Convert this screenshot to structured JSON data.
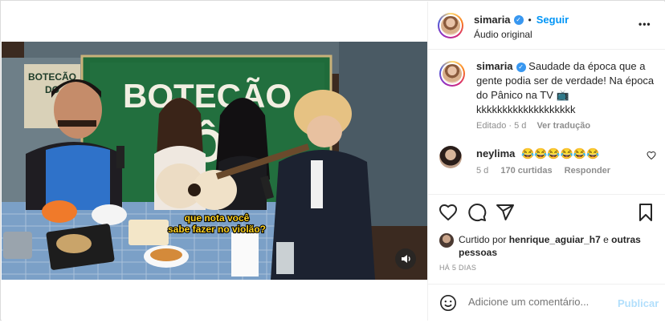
{
  "post": {
    "author": "simaria",
    "follow_label": "Seguir",
    "audio_label": "Áudio original",
    "more_label": "•••",
    "caption": "Saudade da época que a gente podia ser de verdade! Na época do Pânico na TV 📺 kkkkkkkkkkkkkkkkkkk",
    "caption_meta_edited": "Editado · 5 d",
    "caption_meta_translate": "Ver tradução"
  },
  "video": {
    "sign_text": "BOTECÃO",
    "sign_text_small_left": "BOTECÃO",
    "sign_text_small_left2": "DO",
    "subtitle_line1": "que nota você",
    "subtitle_line2": "sabe fazer no violão?",
    "mute_icon": "speaker-icon"
  },
  "comment": {
    "author": "neylima",
    "text": "😂😂😂😂😂😂",
    "time": "5 d",
    "likes": "170 curtidas",
    "reply_label": "Responder"
  },
  "likes": {
    "prefix": "Curtido por",
    "user": "henrique_aguiar_h7",
    "joiner": "e",
    "others": "outras pessoas",
    "date": "HÁ 5 DIAS"
  },
  "add_comment": {
    "placeholder": "Adicione um comentário...",
    "publish_label": "Publicar"
  },
  "colors": {
    "accent": "#0095f6",
    "verified": "#3897f0",
    "sign_green": "#1f6b3a"
  }
}
